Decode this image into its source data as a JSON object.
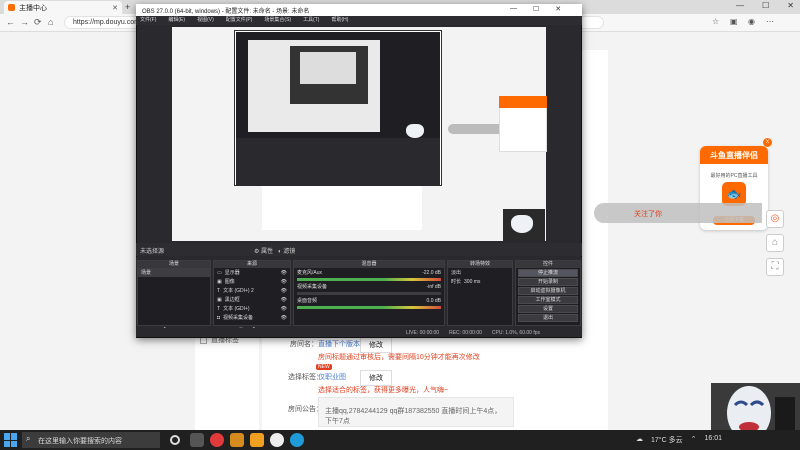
{
  "browser": {
    "tab_title": "主播中心",
    "new_tab": "+",
    "url": "https://mp.douyu.com/...",
    "back": "←",
    "forward": "→",
    "refresh": "⟳",
    "home": "⌂"
  },
  "page": {
    "checkbox_label": "直播标签",
    "room_name_label": "房间名：",
    "room_name_link": "直播下个版本",
    "room_name_edit": "修改",
    "room_name_notice": "房间标题通过审核后，需要间隔10分钟才能再次修改",
    "tag_label": "选择标签：",
    "tag_new_badge": "NEW",
    "tag_link": "仅职业图",
    "tag_edit": "修改",
    "tag_notice": "选择适合的标签，获得更多曝光，人气嗨~",
    "announce_label": "房间公告：",
    "announce_text": "主播qq,2784244129 qq群187382550 直播时间上午4点，下午7点",
    "follow_text": "关注了你"
  },
  "promo": {
    "title": "斗鱼直播伴侣",
    "subtitle": "最好用的PC直播工具",
    "button": "立即下载",
    "close": "x"
  },
  "obs": {
    "title": "OBS 27.0.0 (64-bit, windows) - 配置文件: 未命名 - 场景: 未命名",
    "menu": [
      "文件(F)",
      "编辑(E)",
      "视图(V)",
      "配置文件(P)",
      "场景集合(S)",
      "工具(T)",
      "帮助(H)"
    ],
    "scene_bar_label": "未选择源",
    "scene_bar_props": "属性",
    "scene_bar_filters": "滤镜",
    "docks": {
      "scenes": {
        "title": "场景",
        "items": [
          "场景"
        ]
      },
      "sources": {
        "title": "来源",
        "items": [
          "显示器",
          "图像",
          "文本 (GDI+) 2",
          "黑边框",
          "文本 (GDI+)",
          "视频采集设备"
        ]
      },
      "mixer": {
        "title": "混音器",
        "channels": [
          {
            "name": "麦克风/Aux",
            "db": "-22.0 dB"
          },
          {
            "name": "视频采集设备",
            "db": "-inf dB"
          },
          {
            "name": "桌面音频",
            "db": "0.0 dB"
          }
        ]
      },
      "transitions": {
        "title": "转场特效",
        "type": "淡出",
        "duration_label": "时长",
        "duration": "300 ms"
      },
      "controls": {
        "title": "控件",
        "buttons": [
          "停止推流",
          "开始录制",
          "启动虚拟摄像机",
          "工作室模式",
          "设置",
          "退出"
        ]
      }
    },
    "status": {
      "live": "LIVE: 00:00:00",
      "rec": "REC: 00:00:00",
      "cpu": "CPU: 1.0%, 60.00 fps"
    }
  },
  "taskbar": {
    "search_placeholder": "在这里输入你要搜索的内容",
    "weather": "17°C 多云",
    "time": "16:01"
  },
  "colors": {
    "accent": "#ff6a00",
    "red_text": "#e0401f",
    "link": "#4a7fd1",
    "obs_bg": "#2a2a2e"
  }
}
